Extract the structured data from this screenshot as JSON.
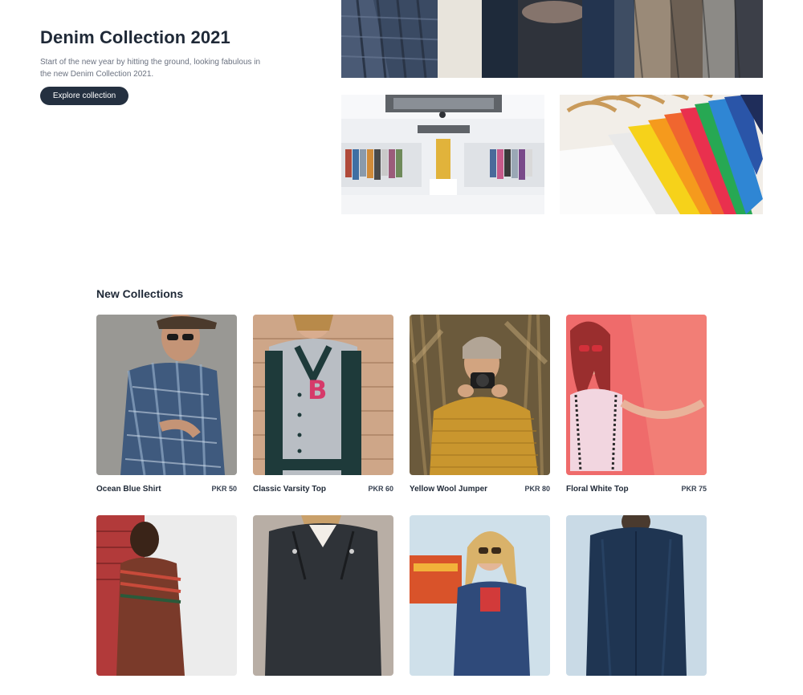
{
  "hero": {
    "title": "Denim Collection 2021",
    "subtitle": "Start of the new year by hitting the ground, looking fabulous in the new Denim Collection 2021.",
    "cta_label": "Explore collection"
  },
  "collections": {
    "title": "New Collections",
    "products": [
      {
        "name": "Ocean Blue Shirt",
        "price": "PKR 50"
      },
      {
        "name": "Classic Varsity Top",
        "price": "PKR 60"
      },
      {
        "name": "Yellow Wool Jumper",
        "price": "PKR 80"
      },
      {
        "name": "Floral White Top",
        "price": "PKR 75"
      },
      {
        "name": "",
        "price": ""
      },
      {
        "name": "",
        "price": ""
      },
      {
        "name": "",
        "price": ""
      },
      {
        "name": "",
        "price": ""
      }
    ]
  },
  "colors": {
    "text_dark": "#1f2937",
    "text_muted": "#6b7280",
    "button_bg": "#243040",
    "button_text": "#ffffff"
  }
}
